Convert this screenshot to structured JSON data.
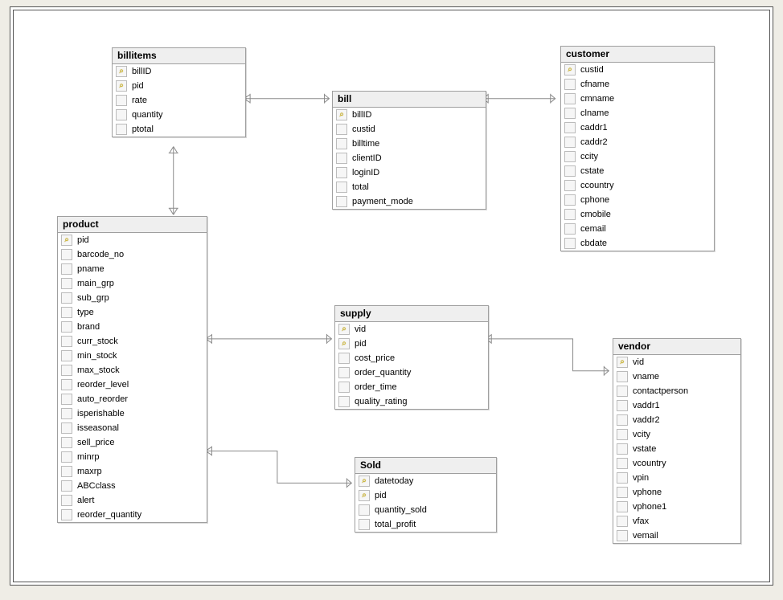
{
  "tables": {
    "billitems": {
      "title": "billitems",
      "columns": [
        {
          "name": "billID",
          "key": true
        },
        {
          "name": "pid",
          "key": true
        },
        {
          "name": "rate",
          "key": false
        },
        {
          "name": "quantity",
          "key": false
        },
        {
          "name": "ptotal",
          "key": false
        }
      ]
    },
    "bill": {
      "title": "bill",
      "columns": [
        {
          "name": "billID",
          "key": true
        },
        {
          "name": "custid",
          "key": false
        },
        {
          "name": "billtime",
          "key": false
        },
        {
          "name": "clientID",
          "key": false
        },
        {
          "name": "loginID",
          "key": false
        },
        {
          "name": "total",
          "key": false
        },
        {
          "name": "payment_mode",
          "key": false
        }
      ]
    },
    "customer": {
      "title": "customer",
      "columns": [
        {
          "name": "custid",
          "key": true
        },
        {
          "name": "cfname",
          "key": false
        },
        {
          "name": "cmname",
          "key": false
        },
        {
          "name": "clname",
          "key": false
        },
        {
          "name": "caddr1",
          "key": false
        },
        {
          "name": "caddr2",
          "key": false
        },
        {
          "name": "ccity",
          "key": false
        },
        {
          "name": "cstate",
          "key": false
        },
        {
          "name": "ccountry",
          "key": false
        },
        {
          "name": "cphone",
          "key": false
        },
        {
          "name": "cmobile",
          "key": false
        },
        {
          "name": "cemail",
          "key": false
        },
        {
          "name": "cbdate",
          "key": false
        }
      ]
    },
    "product": {
      "title": "product",
      "columns": [
        {
          "name": "pid",
          "key": true
        },
        {
          "name": "barcode_no",
          "key": false
        },
        {
          "name": "pname",
          "key": false
        },
        {
          "name": "main_grp",
          "key": false
        },
        {
          "name": "sub_grp",
          "key": false
        },
        {
          "name": "type",
          "key": false
        },
        {
          "name": "brand",
          "key": false
        },
        {
          "name": "curr_stock",
          "key": false
        },
        {
          "name": "min_stock",
          "key": false
        },
        {
          "name": "max_stock",
          "key": false
        },
        {
          "name": "reorder_level",
          "key": false
        },
        {
          "name": "auto_reorder",
          "key": false
        },
        {
          "name": "isperishable",
          "key": false
        },
        {
          "name": "isseasonal",
          "key": false
        },
        {
          "name": "sell_price",
          "key": false
        },
        {
          "name": "minrp",
          "key": false
        },
        {
          "name": "maxrp",
          "key": false
        },
        {
          "name": "ABCclass",
          "key": false
        },
        {
          "name": "alert",
          "key": false
        },
        {
          "name": "reorder_quantity",
          "key": false
        }
      ]
    },
    "supply": {
      "title": "supply",
      "columns": [
        {
          "name": "vid",
          "key": true
        },
        {
          "name": "pid",
          "key": true
        },
        {
          "name": "cost_price",
          "key": false
        },
        {
          "name": "order_quantity",
          "key": false
        },
        {
          "name": "order_time",
          "key": false
        },
        {
          "name": "quality_rating",
          "key": false
        }
      ]
    },
    "sold": {
      "title": "Sold",
      "columns": [
        {
          "name": "datetoday",
          "key": true
        },
        {
          "name": "pid",
          "key": true
        },
        {
          "name": "quantity_sold",
          "key": false
        },
        {
          "name": "total_profit",
          "key": false
        }
      ]
    },
    "vendor": {
      "title": "vendor",
      "columns": [
        {
          "name": "vid",
          "key": true
        },
        {
          "name": "vname",
          "key": false
        },
        {
          "name": "contactperson",
          "key": false
        },
        {
          "name": "vaddr1",
          "key": false
        },
        {
          "name": "vaddr2",
          "key": false
        },
        {
          "name": "vcity",
          "key": false
        },
        {
          "name": "vstate",
          "key": false
        },
        {
          "name": "vcountry",
          "key": false
        },
        {
          "name": "vpin",
          "key": false
        },
        {
          "name": "vphone",
          "key": false
        },
        {
          "name": "vphone1",
          "key": false
        },
        {
          "name": "vfax",
          "key": false
        },
        {
          "name": "vemail",
          "key": false
        }
      ]
    }
  },
  "relationships": [
    {
      "from": "billitems",
      "to": "bill",
      "via": "billID"
    },
    {
      "from": "billitems",
      "to": "product",
      "via": "pid"
    },
    {
      "from": "bill",
      "to": "customer",
      "via": "custid"
    },
    {
      "from": "supply",
      "to": "product",
      "via": "pid"
    },
    {
      "from": "supply",
      "to": "vendor",
      "via": "vid"
    },
    {
      "from": "sold",
      "to": "product",
      "via": "pid"
    }
  ]
}
